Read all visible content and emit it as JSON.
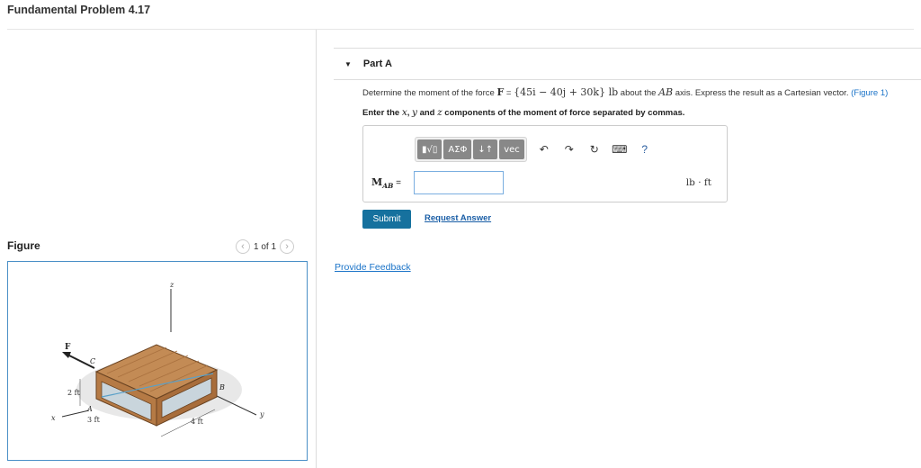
{
  "page": {
    "title": "Fundamental Problem 4.17"
  },
  "figure": {
    "label": "Figure",
    "pager_text": "1 of 1",
    "prev_icon": "chevron-left-icon",
    "next_icon": "chevron-right-icon",
    "labels": {
      "z": "z",
      "x": "x",
      "y": "y",
      "F": "F",
      "A": "A",
      "B": "B",
      "C": "C",
      "dim_2ft": "2 ft",
      "dim_3ft": "3 ft",
      "dim_4ft": "4 ft"
    }
  },
  "part": {
    "title": "Part A",
    "caret_icon": "caret-down-icon",
    "question": {
      "prefix": "Determine the moment of the force ",
      "force_symbol": "F",
      "eq_sign": " = ",
      "vector": "{45i − 40j + 30k}",
      "unit": " lb",
      "mid": " about the ",
      "axis": "AB",
      "suffix": " axis. Express the result as a Cartesian vector. ",
      "link": "(Figure 1)"
    },
    "instruction": {
      "pre": "Enter the ",
      "x": "x",
      "sep1": ", ",
      "y": "y",
      "sep2": " and ",
      "z": "z",
      "post": " components of the moment of force separated by commas."
    },
    "toolbar": {
      "templates": "▮√▯",
      "greek": "ΑΣΦ",
      "arrows": "↓↑",
      "vec": "vec",
      "undo": "↶",
      "redo": "↷",
      "reset": "↻",
      "keyboard": "⌨",
      "help": "?"
    },
    "answer": {
      "label_main": "M",
      "label_sub": "AB",
      "label_eq": " =",
      "value": "",
      "unit": "lb · ft"
    },
    "submit_label": "Submit",
    "request_label": "Request Answer"
  },
  "feedback_label": "Provide Feedback",
  "colors": {
    "accent": "#16719e",
    "link": "#1a73c8",
    "figure_border": "#4a8fc7",
    "crate": "#b57a45"
  }
}
